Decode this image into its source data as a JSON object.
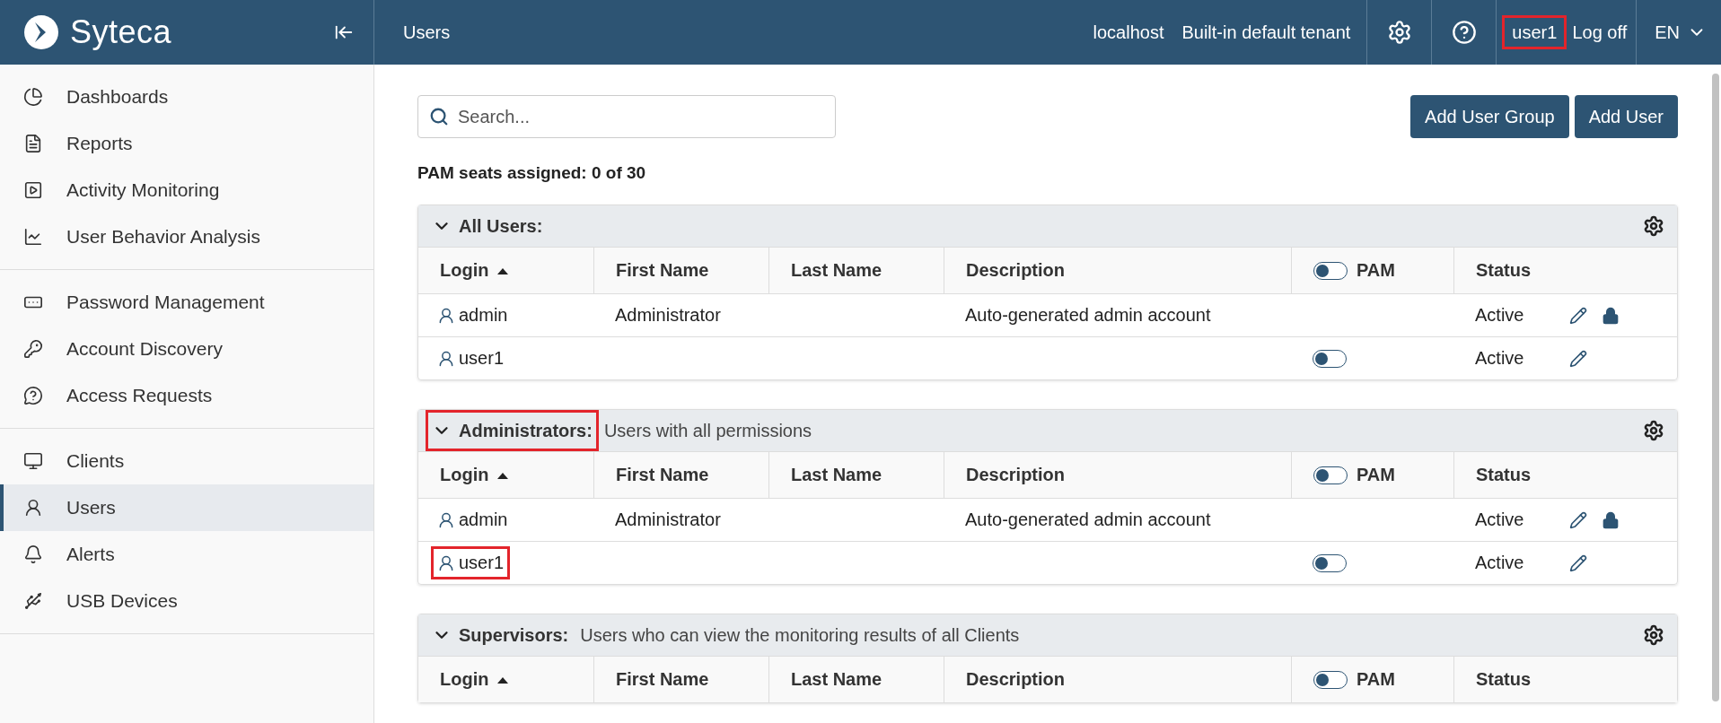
{
  "header": {
    "logo": "Syteca",
    "page_title": "Users",
    "host": "localhost",
    "tenant": "Built-in default tenant",
    "user": {
      "label": "user1",
      "highlighted": true
    },
    "log_off": "Log off",
    "language": "EN"
  },
  "sidebar": {
    "sections": [
      [
        {
          "label": "Dashboards",
          "selected": false
        },
        {
          "label": "Reports",
          "selected": false
        },
        {
          "label": "Activity Monitoring",
          "selected": false
        },
        {
          "label": "User Behavior Analysis",
          "selected": false
        }
      ],
      [
        {
          "label": "Password Management",
          "selected": false
        },
        {
          "label": "Account Discovery",
          "selected": false
        },
        {
          "label": "Access Requests",
          "selected": false
        }
      ],
      [
        {
          "label": "Clients",
          "selected": false
        },
        {
          "label": "Users",
          "selected": true
        },
        {
          "label": "Alerts",
          "selected": false
        },
        {
          "label": "USB Devices",
          "selected": false
        }
      ]
    ]
  },
  "search": {
    "placeholder": "Search..."
  },
  "buttons": [
    "Add User Group",
    "Add User"
  ],
  "seats": "PAM seats assigned: 0 of 30",
  "groups": [
    {
      "name": "All Users:",
      "expanded": true,
      "highlighted": false,
      "columns": [
        {
          "label": "Login",
          "sorted": true
        },
        {
          "label": "First Name",
          "sorted": false
        },
        {
          "label": "Last Name",
          "sorted": false
        },
        {
          "label": "Description",
          "sorted": false
        },
        {
          "label": "PAM",
          "sorted": false,
          "toggle_on": false
        },
        {
          "label": "Status",
          "sorted": false
        }
      ],
      "rows": [
        {
          "login": "admin",
          "first_name": "Administrator",
          "description": "Auto-generated admin account",
          "status": "Active",
          "locked": true,
          "highlighted": false
        },
        {
          "login": "user1",
          "pam_on": false,
          "status": "Active",
          "highlighted": false
        }
      ]
    },
    {
      "name": "Administrators:",
      "description": "Users with all permissions",
      "expanded": true,
      "highlighted": true,
      "columns": [
        {
          "label": "Login",
          "sorted": true
        },
        {
          "label": "First Name",
          "sorted": false
        },
        {
          "label": "Last Name",
          "sorted": false
        },
        {
          "label": "Description",
          "sorted": false
        },
        {
          "label": "PAM",
          "sorted": false,
          "toggle_on": false
        },
        {
          "label": "Status",
          "sorted": false
        }
      ],
      "rows": [
        {
          "login": "admin",
          "first_name": "Administrator",
          "description": "Auto-generated admin account",
          "status": "Active",
          "locked": true,
          "highlighted": false
        },
        {
          "login": "user1",
          "pam_on": false,
          "status": "Active",
          "highlighted": true
        }
      ]
    },
    {
      "name": "Supervisors:",
      "description": "Users who can view the monitoring results of all Clients",
      "expanded": true,
      "highlighted": false,
      "columns": [
        {
          "label": "Login",
          "sorted": true
        },
        {
          "label": "First Name",
          "sorted": false
        },
        {
          "label": "Last Name",
          "sorted": false
        },
        {
          "label": "Description",
          "sorted": false
        },
        {
          "label": "PAM",
          "sorted": false,
          "toggle_on": false
        },
        {
          "label": "Status",
          "sorted": false
        }
      ]
    }
  ]
}
